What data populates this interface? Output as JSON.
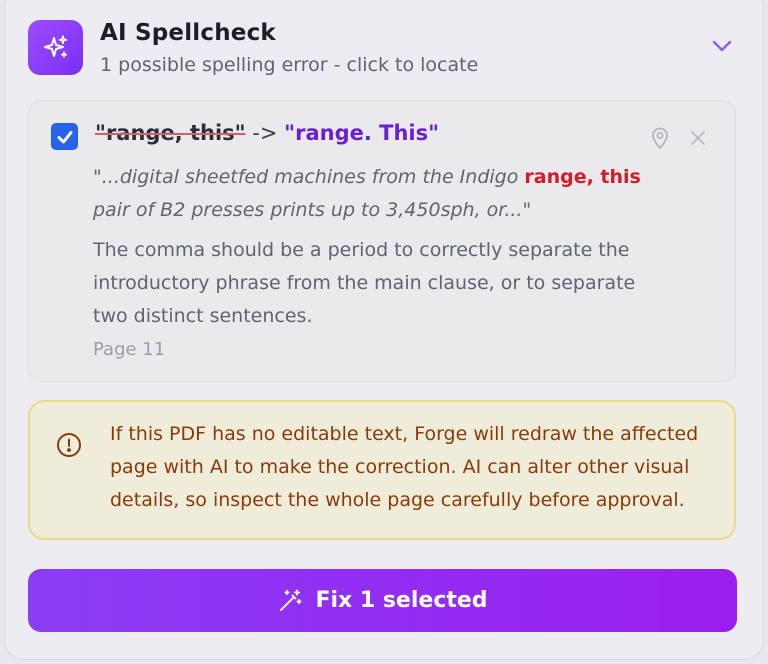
{
  "header": {
    "title": "AI Spellcheck",
    "subtitle": "1 possible spelling error - click to locate",
    "icon": "sparkles-icon",
    "collapse_icon": "chevron-down-icon"
  },
  "issue": {
    "selected": true,
    "original": "\"range, this\"",
    "arrow": "->",
    "replacement": "\"range. This\"",
    "context_before": "\"...digital sheetfed machines from the Indigo ",
    "context_highlight": "range, this",
    "context_after": " pair of B2 presses prints up to 3,450sph, or...\"",
    "explanation": "The comma should be a period to correctly separate the introductory phrase from the main clause, or to separate two distinct sentences.",
    "page": "Page 11",
    "locate_icon": "map-pin-icon",
    "dismiss_icon": "close-icon"
  },
  "warning": {
    "icon": "alert-circle-icon",
    "text": "If this PDF has no editable text, Forge will redraw the affected page with AI to make the correction. AI can alter other visual details, so inspect the whole page carefully before approval."
  },
  "action": {
    "label": "Fix 1 selected",
    "icon": "magic-wand-icon"
  },
  "colors": {
    "accent": "#7b2ff2",
    "checkbox": "#2563eb",
    "error_highlight": "#d41b2a",
    "warning_text": "#8a3a0a",
    "warning_border": "#ecd98a"
  }
}
